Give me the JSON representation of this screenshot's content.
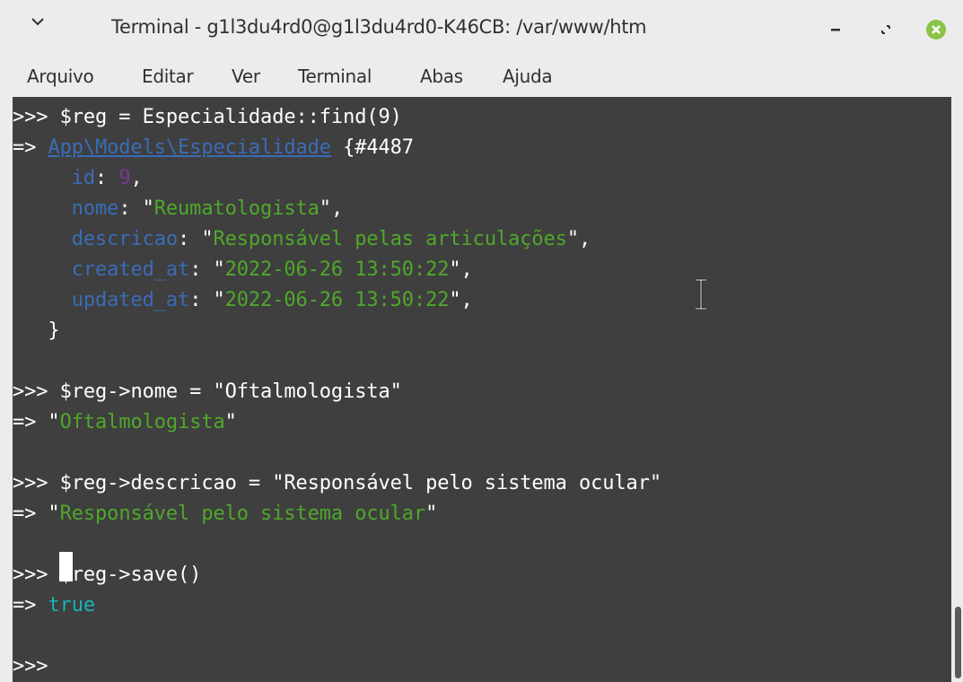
{
  "window": {
    "title": "Terminal - g1l3du4rd0@g1l3du4rd0-K46CB: /var/www/htm",
    "minimize_icon": "minimize-icon",
    "restore_icon": "restore-icon",
    "close_icon": "close-icon",
    "menu_icon": "chevron-down-icon",
    "close_color": "#8bc34a"
  },
  "menu": {
    "items": [
      "Arquivo",
      "Editar",
      "Ver",
      "Terminal",
      "Abas",
      "Ajuda"
    ]
  },
  "terminal": {
    "bg_color": "#3f3f3f",
    "lines": [
      {
        "spans": [
          {
            "t": ">>> $reg = Especialidade::find(9)",
            "c": "w"
          }
        ]
      },
      {
        "spans": [
          {
            "t": "=> ",
            "c": "w"
          },
          {
            "t": "App\\Models\\Especialidade",
            "c": "lnk"
          },
          {
            "t": " {#4487",
            "c": "w"
          }
        ]
      },
      {
        "spans": [
          {
            "t": "     id",
            "c": "b"
          },
          {
            "t": ": ",
            "c": "w"
          },
          {
            "t": "9",
            "c": "p"
          },
          {
            "t": ",",
            "c": "w"
          }
        ]
      },
      {
        "spans": [
          {
            "t": "     nome",
            "c": "b"
          },
          {
            "t": ": \"",
            "c": "w"
          },
          {
            "t": "Reumatologista",
            "c": "g"
          },
          {
            "t": "\",",
            "c": "w"
          }
        ]
      },
      {
        "spans": [
          {
            "t": "     descricao",
            "c": "b"
          },
          {
            "t": ": \"",
            "c": "w"
          },
          {
            "t": "Responsável pelas articulações",
            "c": "g"
          },
          {
            "t": "\",",
            "c": "w"
          }
        ]
      },
      {
        "spans": [
          {
            "t": "     created_at",
            "c": "b"
          },
          {
            "t": ": \"",
            "c": "w"
          },
          {
            "t": "2022-06-26 13:50:22",
            "c": "g"
          },
          {
            "t": "\",",
            "c": "w"
          }
        ]
      },
      {
        "spans": [
          {
            "t": "     updated_at",
            "c": "b"
          },
          {
            "t": ": \"",
            "c": "w"
          },
          {
            "t": "2022-06-26 13:50:22",
            "c": "g"
          },
          {
            "t": "\",",
            "c": "w"
          }
        ]
      },
      {
        "spans": [
          {
            "t": "   }",
            "c": "w"
          }
        ]
      },
      {
        "spans": [
          {
            "t": "",
            "c": "w"
          }
        ]
      },
      {
        "spans": [
          {
            "t": ">>> $reg->nome = \"Oftalmologista\"",
            "c": "w"
          }
        ]
      },
      {
        "spans": [
          {
            "t": "=> \"",
            "c": "w"
          },
          {
            "t": "Oftalmologista",
            "c": "g"
          },
          {
            "t": "\"",
            "c": "w"
          }
        ]
      },
      {
        "spans": [
          {
            "t": "",
            "c": "w"
          }
        ]
      },
      {
        "spans": [
          {
            "t": ">>> $reg->descricao = \"Responsável pelo sistema ocular\"",
            "c": "w"
          }
        ]
      },
      {
        "spans": [
          {
            "t": "=> \"",
            "c": "w"
          },
          {
            "t": "Responsável pelo sistema ocular",
            "c": "g"
          },
          {
            "t": "\"",
            "c": "w"
          }
        ]
      },
      {
        "spans": [
          {
            "t": "",
            "c": "w"
          }
        ]
      },
      {
        "spans": [
          {
            "t": ">>> $reg->save()",
            "c": "w"
          }
        ]
      },
      {
        "spans": [
          {
            "t": "=> ",
            "c": "w"
          },
          {
            "t": "true",
            "c": "c"
          }
        ]
      },
      {
        "spans": [
          {
            "t": "",
            "c": "w"
          }
        ]
      },
      {
        "spans": [
          {
            "t": ">>> ",
            "c": "w"
          }
        ]
      }
    ]
  }
}
